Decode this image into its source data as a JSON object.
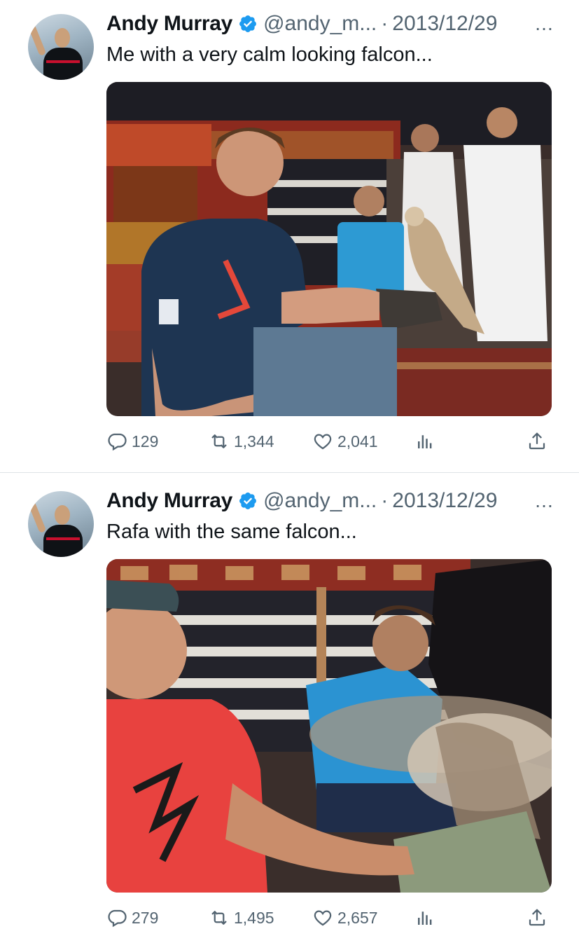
{
  "tweets": [
    {
      "author": {
        "name": "Andy Murray",
        "handle": "@andy_m...",
        "verified": true
      },
      "separator": "·",
      "date": "2013/12/29",
      "more_icon": "…",
      "text": "Me with a very calm looking falcon...",
      "stats": {
        "replies": "129",
        "retweets": "1,344",
        "likes": "2,041"
      }
    },
    {
      "author": {
        "name": "Andy Murray",
        "handle": "@andy_m...",
        "verified": true
      },
      "separator": "·",
      "date": "2013/12/29",
      "more_icon": "…",
      "text": "Rafa with the same falcon...",
      "stats": {
        "replies": "279",
        "retweets": "1,495",
        "likes": "2,657"
      }
    }
  ],
  "icons": {
    "verified": "verified-badge-icon",
    "reply": "reply-icon",
    "retweet": "retweet-icon",
    "like": "heart-icon",
    "views": "analytics-icon",
    "share": "share-icon"
  },
  "colors": {
    "verified": "#1d9bf0",
    "secondary_text": "#536471",
    "primary_text": "#0f1419"
  }
}
